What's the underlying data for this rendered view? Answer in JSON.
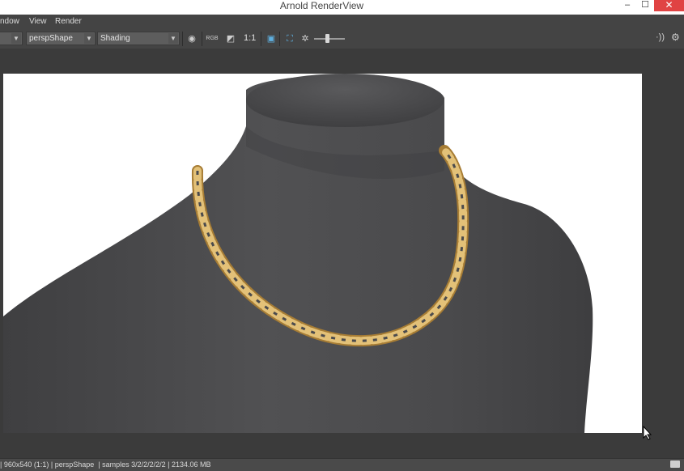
{
  "window": {
    "title": "Arnold RenderView"
  },
  "menus": [
    "ndow",
    "View",
    "Render"
  ],
  "toolbar": {
    "camera": "perspShape",
    "aov": "Shading",
    "ratio": "1:1",
    "exposure": "0"
  },
  "status": {
    "text": "| 960x540 (1:1) | perspShape  | samples 3/2/2/2/2/2 | 2134.06 MB"
  },
  "colors": {
    "stop_button": "#c4363b",
    "window_close": "#e04343",
    "chain_gold": "#d8b35e",
    "mannequin": "#4b4b4d"
  }
}
